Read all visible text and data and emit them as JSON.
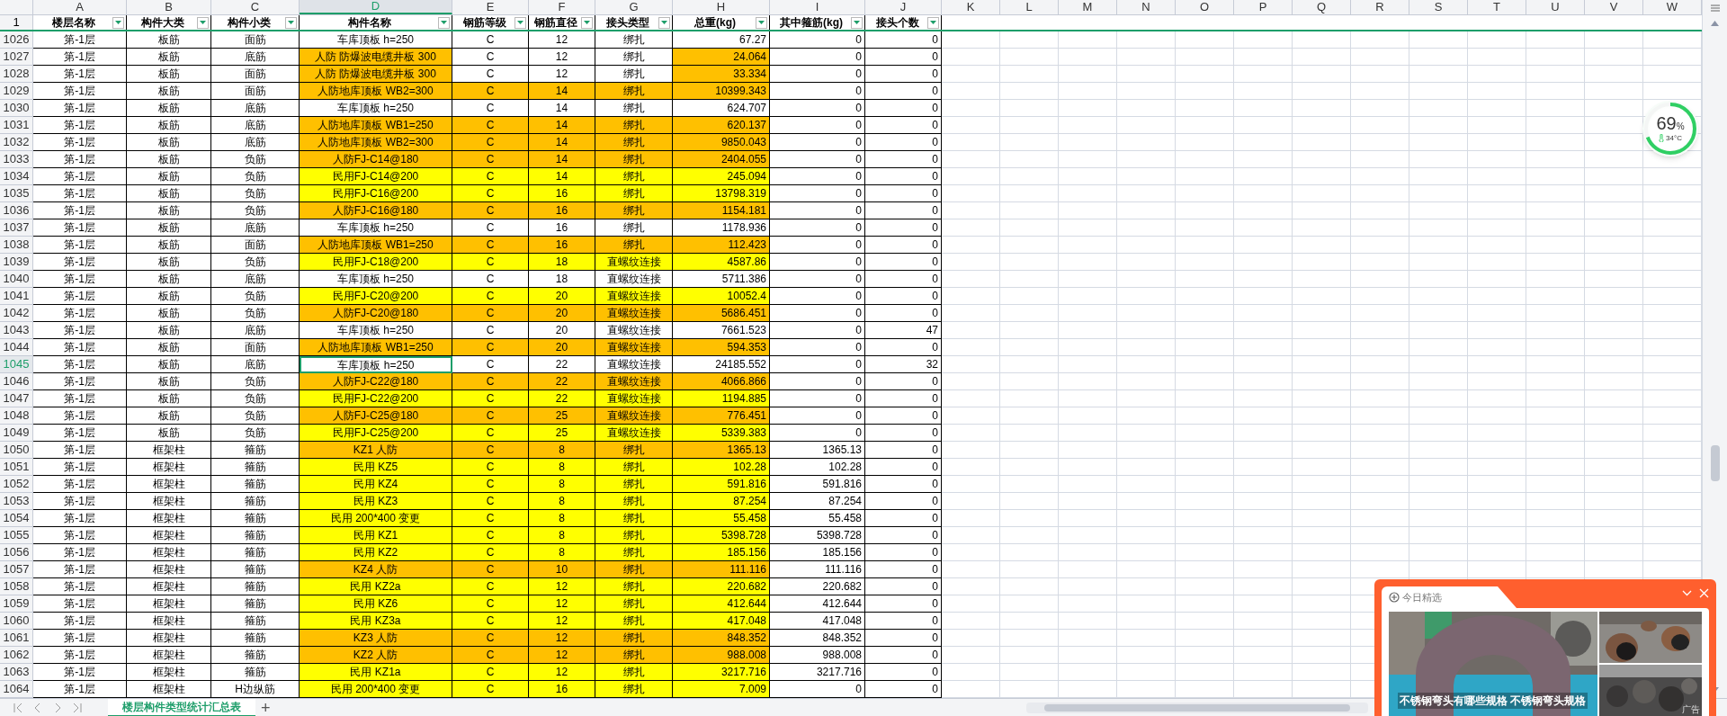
{
  "column_letters": [
    {
      "label": "A",
      "selected": false
    },
    {
      "label": "B",
      "selected": false
    },
    {
      "label": "C",
      "selected": false
    },
    {
      "label": "D",
      "selected": true
    },
    {
      "label": "E",
      "selected": false
    },
    {
      "label": "F",
      "selected": false
    },
    {
      "label": "G",
      "selected": false
    },
    {
      "label": "H",
      "selected": false
    },
    {
      "label": "I",
      "selected": false
    },
    {
      "label": "J",
      "selected": false
    },
    {
      "label": "K",
      "selected": false
    },
    {
      "label": "L",
      "selected": false
    },
    {
      "label": "M",
      "selected": false
    },
    {
      "label": "N",
      "selected": false
    },
    {
      "label": "O",
      "selected": false
    },
    {
      "label": "P",
      "selected": false
    },
    {
      "label": "Q",
      "selected": false
    },
    {
      "label": "R",
      "selected": false
    },
    {
      "label": "S",
      "selected": false
    },
    {
      "label": "T",
      "selected": false
    },
    {
      "label": "U",
      "selected": false
    },
    {
      "label": "V",
      "selected": false
    },
    {
      "label": "W",
      "selected": false
    }
  ],
  "header_row_number": "1",
  "headers": [
    "楼层名称",
    "构件大类",
    "构件小类",
    "构件名称",
    "钢筋等级",
    "钢筋直径",
    "接头类型",
    "总重(kg)",
    "其中箍筋(kg)",
    "接头个数"
  ],
  "rows": [
    {
      "row_number": "1026",
      "cells": [
        "第-1层",
        "板筋",
        "面筋",
        "车库顶板 h=250",
        "C",
        "12",
        "绑扎",
        "67.27",
        "0",
        "0"
      ],
      "color": "#ffffff",
      "selected": false
    },
    {
      "row_number": "1027",
      "cells": [
        "第-1层",
        "板筋",
        "底筋",
        "人防 防爆波电缆井板 300",
        "C",
        "12",
        "绑扎",
        "24.064",
        "0",
        "0"
      ],
      "color": "#ffc000",
      "middle_filled": false,
      "selected": false
    },
    {
      "row_number": "1028",
      "cells": [
        "第-1层",
        "板筋",
        "面筋",
        "人防 防爆波电缆井板 300",
        "C",
        "12",
        "绑扎",
        "33.334",
        "0",
        "0"
      ],
      "color": "#ffc000",
      "middle_filled": false,
      "selected": false
    },
    {
      "row_number": "1029",
      "cells": [
        "第-1层",
        "板筋",
        "面筋",
        "人防地库顶板 WB2=300",
        "C",
        "14",
        "绑扎",
        "10399.343",
        "0",
        "0"
      ],
      "color": "#ffc000",
      "middle_filled": true,
      "selected": false
    },
    {
      "row_number": "1030",
      "cells": [
        "第-1层",
        "板筋",
        "底筋",
        "车库顶板 h=250",
        "C",
        "14",
        "绑扎",
        "624.707",
        "0",
        "0"
      ],
      "color": "#ffffff",
      "selected": false
    },
    {
      "row_number": "1031",
      "cells": [
        "第-1层",
        "板筋",
        "底筋",
        "人防地库顶板 WB1=250",
        "C",
        "14",
        "绑扎",
        "620.137",
        "0",
        "0"
      ],
      "color": "#ffc000",
      "middle_filled": true,
      "selected": false
    },
    {
      "row_number": "1032",
      "cells": [
        "第-1层",
        "板筋",
        "底筋",
        "人防地库顶板 WB2=300",
        "C",
        "14",
        "绑扎",
        "9850.043",
        "0",
        "0"
      ],
      "color": "#ffc000",
      "middle_filled": true,
      "selected": false
    },
    {
      "row_number": "1033",
      "cells": [
        "第-1层",
        "板筋",
        "负筋",
        "人防FJ-C14@180",
        "C",
        "14",
        "绑扎",
        "2404.055",
        "0",
        "0"
      ],
      "color": "#ffc000",
      "middle_filled": true,
      "selected": false
    },
    {
      "row_number": "1034",
      "cells": [
        "第-1层",
        "板筋",
        "负筋",
        "民用FJ-C14@200",
        "C",
        "14",
        "绑扎",
        "245.094",
        "0",
        "0"
      ],
      "color": "#ffff00",
      "middle_filled": true,
      "selected": false
    },
    {
      "row_number": "1035",
      "cells": [
        "第-1层",
        "板筋",
        "负筋",
        "民用FJ-C16@200",
        "C",
        "16",
        "绑扎",
        "13798.319",
        "0",
        "0"
      ],
      "color": "#ffff00",
      "middle_filled": true,
      "selected": false
    },
    {
      "row_number": "1036",
      "cells": [
        "第-1层",
        "板筋",
        "负筋",
        "人防FJ-C16@180",
        "C",
        "16",
        "绑扎",
        "1154.181",
        "0",
        "0"
      ],
      "color": "#ffc000",
      "middle_filled": true,
      "selected": false
    },
    {
      "row_number": "1037",
      "cells": [
        "第-1层",
        "板筋",
        "底筋",
        "车库顶板 h=250",
        "C",
        "16",
        "绑扎",
        "1178.936",
        "0",
        "0"
      ],
      "color": "#ffffff",
      "selected": false
    },
    {
      "row_number": "1038",
      "cells": [
        "第-1层",
        "板筋",
        "面筋",
        "人防地库顶板 WB1=250",
        "C",
        "16",
        "绑扎",
        "112.423",
        "0",
        "0"
      ],
      "color": "#ffc000",
      "middle_filled": true,
      "selected": false
    },
    {
      "row_number": "1039",
      "cells": [
        "第-1层",
        "板筋",
        "负筋",
        "民用FJ-C18@200",
        "C",
        "18",
        "直螺纹连接",
        "4587.86",
        "0",
        "0"
      ],
      "color": "#ffff00",
      "middle_filled": true,
      "selected": false
    },
    {
      "row_number": "1040",
      "cells": [
        "第-1层",
        "板筋",
        "底筋",
        "车库顶板 h=250",
        "C",
        "18",
        "直螺纹连接",
        "5711.386",
        "0",
        "0"
      ],
      "color": "#ffffff",
      "selected": false
    },
    {
      "row_number": "1041",
      "cells": [
        "第-1层",
        "板筋",
        "负筋",
        "民用FJ-C20@200",
        "C",
        "20",
        "直螺纹连接",
        "10052.4",
        "0",
        "0"
      ],
      "color": "#ffff00",
      "middle_filled": true,
      "selected": false
    },
    {
      "row_number": "1042",
      "cells": [
        "第-1层",
        "板筋",
        "负筋",
        "人防FJ-C20@180",
        "C",
        "20",
        "直螺纹连接",
        "5686.451",
        "0",
        "0"
      ],
      "color": "#ffc000",
      "middle_filled": true,
      "selected": false
    },
    {
      "row_number": "1043",
      "cells": [
        "第-1层",
        "板筋",
        "底筋",
        "车库顶板 h=250",
        "C",
        "20",
        "直螺纹连接",
        "7661.523",
        "0",
        "47"
      ],
      "color": "#ffffff",
      "selected": false
    },
    {
      "row_number": "1044",
      "cells": [
        "第-1层",
        "板筋",
        "面筋",
        "人防地库顶板 WB1=250",
        "C",
        "20",
        "直螺纹连接",
        "594.353",
        "0",
        "0"
      ],
      "color": "#ffc000",
      "middle_filled": true,
      "selected": false
    },
    {
      "row_number": "1045",
      "cells": [
        "第-1层",
        "板筋",
        "底筋",
        "车库顶板 h=250",
        "C",
        "22",
        "直螺纹连接",
        "24185.552",
        "0",
        "32"
      ],
      "color": "#ffffff",
      "selected": true
    },
    {
      "row_number": "1046",
      "cells": [
        "第-1层",
        "板筋",
        "负筋",
        "人防FJ-C22@180",
        "C",
        "22",
        "直螺纹连接",
        "4066.866",
        "0",
        "0"
      ],
      "color": "#ffc000",
      "middle_filled": true,
      "selected": false
    },
    {
      "row_number": "1047",
      "cells": [
        "第-1层",
        "板筋",
        "负筋",
        "民用FJ-C22@200",
        "C",
        "22",
        "直螺纹连接",
        "1194.885",
        "0",
        "0"
      ],
      "color": "#ffff00",
      "middle_filled": true,
      "selected": false
    },
    {
      "row_number": "1048",
      "cells": [
        "第-1层",
        "板筋",
        "负筋",
        "人防FJ-C25@180",
        "C",
        "25",
        "直螺纹连接",
        "776.451",
        "0",
        "0"
      ],
      "color": "#ffc000",
      "middle_filled": true,
      "selected": false
    },
    {
      "row_number": "1049",
      "cells": [
        "第-1层",
        "板筋",
        "负筋",
        "民用FJ-C25@200",
        "C",
        "25",
        "直螺纹连接",
        "5339.383",
        "0",
        "0"
      ],
      "color": "#ffff00",
      "middle_filled": true,
      "selected": false
    },
    {
      "row_number": "1050",
      "cells": [
        "第-1层",
        "框架柱",
        "箍筋",
        "KZ1 人防",
        "C",
        "8",
        "绑扎",
        "1365.13",
        "1365.13",
        "0"
      ],
      "color": "#ffc000",
      "middle_filled": true,
      "selected": false
    },
    {
      "row_number": "1051",
      "cells": [
        "第-1层",
        "框架柱",
        "箍筋",
        "民用 KZ5",
        "C",
        "8",
        "绑扎",
        "102.28",
        "102.28",
        "0"
      ],
      "color": "#ffff00",
      "middle_filled": true,
      "selected": false
    },
    {
      "row_number": "1052",
      "cells": [
        "第-1层",
        "框架柱",
        "箍筋",
        "民用 KZ4",
        "C",
        "8",
        "绑扎",
        "591.816",
        "591.816",
        "0"
      ],
      "color": "#ffff00",
      "middle_filled": true,
      "selected": false
    },
    {
      "row_number": "1053",
      "cells": [
        "第-1层",
        "框架柱",
        "箍筋",
        "民用 KZ3",
        "C",
        "8",
        "绑扎",
        "87.254",
        "87.254",
        "0"
      ],
      "color": "#ffff00",
      "middle_filled": true,
      "selected": false
    },
    {
      "row_number": "1054",
      "cells": [
        "第-1层",
        "框架柱",
        "箍筋",
        "民用 200*400 变更",
        "C",
        "8",
        "绑扎",
        "55.458",
        "55.458",
        "0"
      ],
      "color": "#ffff00",
      "middle_filled": true,
      "selected": false
    },
    {
      "row_number": "1055",
      "cells": [
        "第-1层",
        "框架柱",
        "箍筋",
        "民用 KZ1",
        "C",
        "8",
        "绑扎",
        "5398.728",
        "5398.728",
        "0"
      ],
      "color": "#ffff00",
      "middle_filled": true,
      "selected": false
    },
    {
      "row_number": "1056",
      "cells": [
        "第-1层",
        "框架柱",
        "箍筋",
        "民用 KZ2",
        "C",
        "8",
        "绑扎",
        "185.156",
        "185.156",
        "0"
      ],
      "color": "#ffff00",
      "middle_filled": true,
      "selected": false
    },
    {
      "row_number": "1057",
      "cells": [
        "第-1层",
        "框架柱",
        "箍筋",
        "KZ4 人防",
        "C",
        "10",
        "绑扎",
        "111.116",
        "111.116",
        "0"
      ],
      "color": "#ffc000",
      "middle_filled": true,
      "selected": false
    },
    {
      "row_number": "1058",
      "cells": [
        "第-1层",
        "框架柱",
        "箍筋",
        "民用 KZ2a",
        "C",
        "12",
        "绑扎",
        "220.682",
        "220.682",
        "0"
      ],
      "color": "#ffff00",
      "middle_filled": true,
      "selected": false
    },
    {
      "row_number": "1059",
      "cells": [
        "第-1层",
        "框架柱",
        "箍筋",
        "民用 KZ6",
        "C",
        "12",
        "绑扎",
        "412.644",
        "412.644",
        "0"
      ],
      "color": "#ffff00",
      "middle_filled": true,
      "selected": false
    },
    {
      "row_number": "1060",
      "cells": [
        "第-1层",
        "框架柱",
        "箍筋",
        "民用 KZ3a",
        "C",
        "12",
        "绑扎",
        "417.048",
        "417.048",
        "0"
      ],
      "color": "#ffff00",
      "middle_filled": true,
      "selected": false
    },
    {
      "row_number": "1061",
      "cells": [
        "第-1层",
        "框架柱",
        "箍筋",
        "KZ3 人防",
        "C",
        "12",
        "绑扎",
        "848.352",
        "848.352",
        "0"
      ],
      "color": "#ffc000",
      "middle_filled": true,
      "selected": false
    },
    {
      "row_number": "1062",
      "cells": [
        "第-1层",
        "框架柱",
        "箍筋",
        "KZ2 人防",
        "C",
        "12",
        "绑扎",
        "988.008",
        "988.008",
        "0"
      ],
      "color": "#ffc000",
      "middle_filled": true,
      "selected": false
    },
    {
      "row_number": "1063",
      "cells": [
        "第-1层",
        "框架柱",
        "箍筋",
        "民用 KZ1a",
        "C",
        "12",
        "绑扎",
        "3217.716",
        "3217.716",
        "0"
      ],
      "color": "#ffff00",
      "middle_filled": true,
      "selected": false
    },
    {
      "row_number": "1064",
      "cells": [
        "第-1层",
        "框架柱",
        "H边纵筋",
        "民用 200*400 变更",
        "C",
        "16",
        "绑扎",
        "7.009",
        "0",
        "0"
      ],
      "color": "#ffff00",
      "middle_filled": true,
      "selected": false
    }
  ],
  "sheet_tabs": [
    {
      "label": "楼层构件类型统计汇总表",
      "selected": true
    }
  ],
  "add_sheet_button": "+",
  "widget": {
    "value": "69",
    "unit": "%",
    "temperature": "34°C",
    "level": 0.69
  },
  "ad": {
    "title": "今日精选",
    "caption": "不锈钢弯头有哪些规格 不锈钢弯头规格",
    "label": "广告"
  }
}
